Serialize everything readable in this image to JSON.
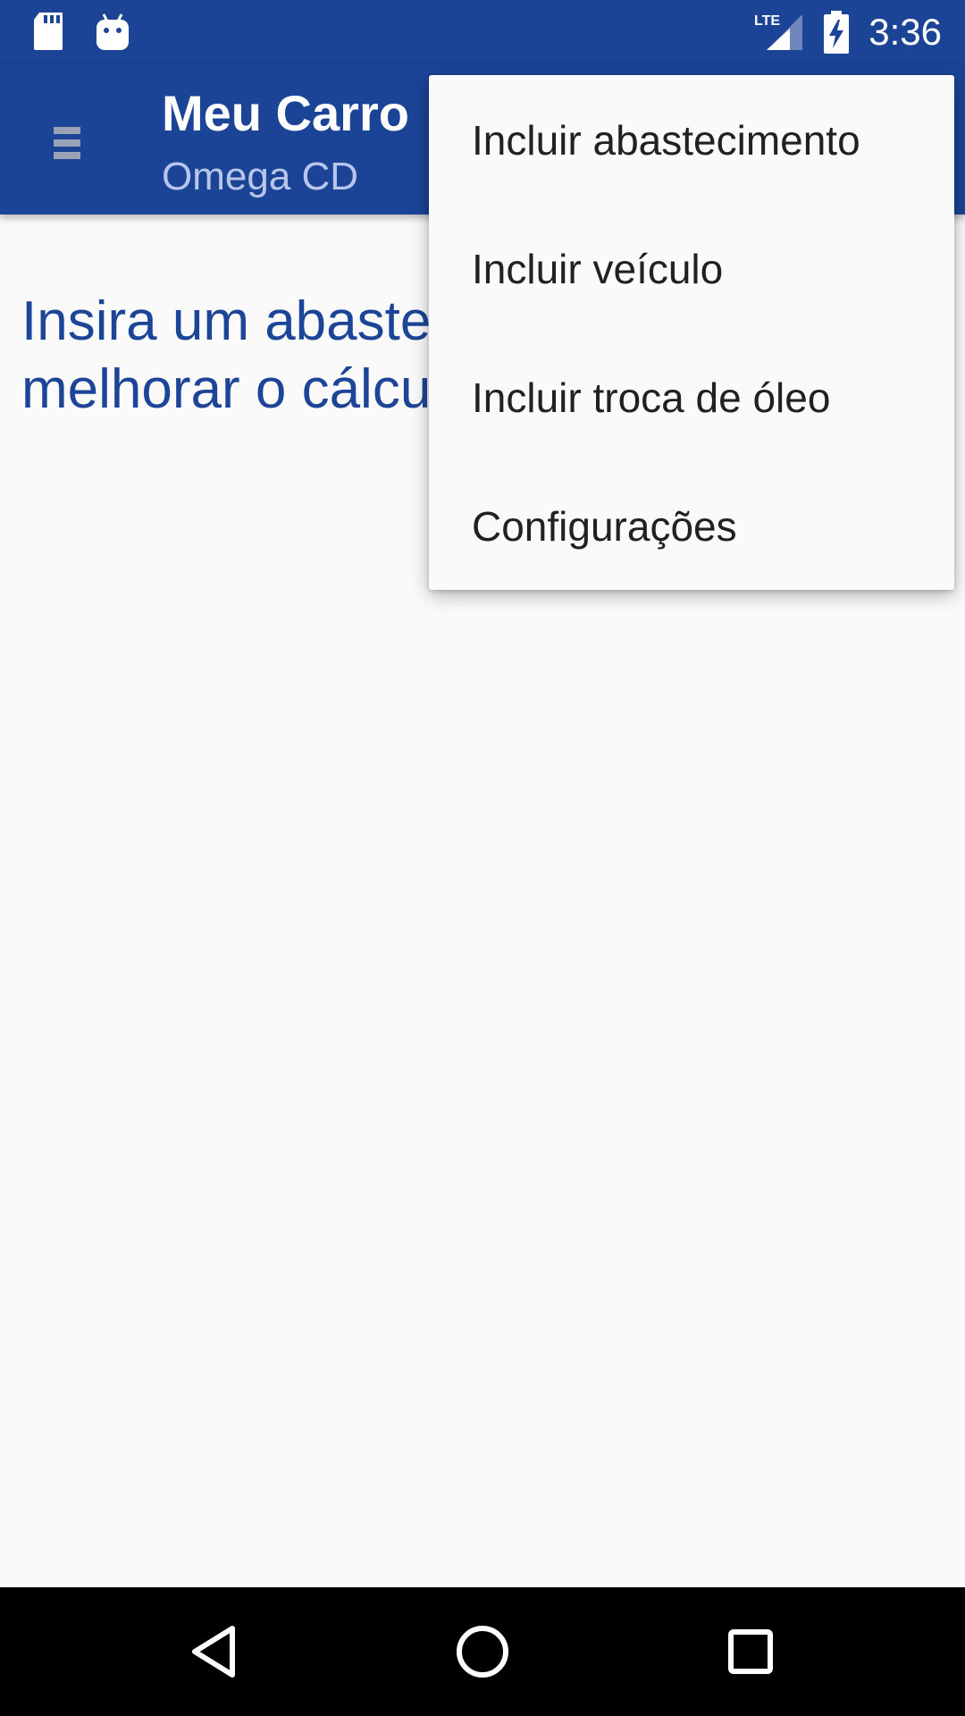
{
  "status_bar": {
    "time": "3:36",
    "network": "LTE",
    "icons": [
      "sd-card-icon",
      "android-debug-icon",
      "lte-signal-icon",
      "battery-charging-icon"
    ]
  },
  "app_bar": {
    "title": "Meu Carro",
    "subtitle": "Omega CD",
    "menu_icon": "hamburger-menu-icon"
  },
  "content": {
    "message": "Insira um abastecimento para melhorar o cálculo do consumo."
  },
  "overflow_menu": {
    "items": [
      {
        "label": "Incluir abastecimento"
      },
      {
        "label": "Incluir veículo"
      },
      {
        "label": "Incluir troca de óleo"
      },
      {
        "label": "Configurações"
      }
    ]
  },
  "nav_bar": {
    "buttons": [
      "back-icon",
      "home-icon",
      "recents-icon"
    ]
  },
  "colors": {
    "primary": "#1b4497",
    "accent_text": "#1d4597",
    "background": "#fafafa",
    "subtitle": "#b7c6ea"
  }
}
